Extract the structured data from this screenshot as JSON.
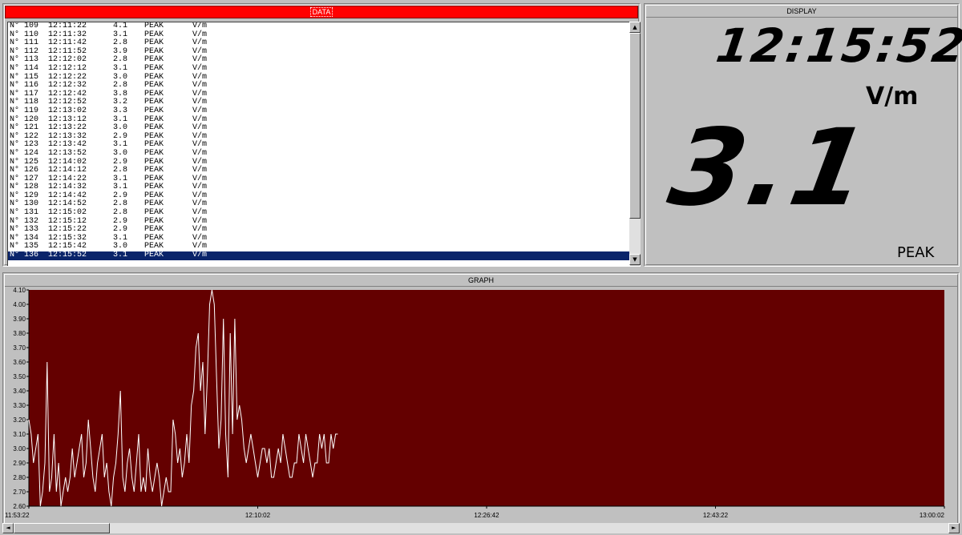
{
  "data_panel": {
    "title": "DATA",
    "selected_index": 27,
    "rows": [
      {
        "n": "N° 109",
        "time": "12:11:22",
        "value": "4.1",
        "mode": "PEAK",
        "unit": "V/m"
      },
      {
        "n": "N° 110",
        "time": "12:11:32",
        "value": "3.1",
        "mode": "PEAK",
        "unit": "V/m"
      },
      {
        "n": "N° 111",
        "time": "12:11:42",
        "value": "2.8",
        "mode": "PEAK",
        "unit": "V/m"
      },
      {
        "n": "N° 112",
        "time": "12:11:52",
        "value": "3.9",
        "mode": "PEAK",
        "unit": "V/m"
      },
      {
        "n": "N° 113",
        "time": "12:12:02",
        "value": "2.8",
        "mode": "PEAK",
        "unit": "V/m"
      },
      {
        "n": "N° 114",
        "time": "12:12:12",
        "value": "3.1",
        "mode": "PEAK",
        "unit": "V/m"
      },
      {
        "n": "N° 115",
        "time": "12:12:22",
        "value": "3.0",
        "mode": "PEAK",
        "unit": "V/m"
      },
      {
        "n": "N° 116",
        "time": "12:12:32",
        "value": "2.8",
        "mode": "PEAK",
        "unit": "V/m"
      },
      {
        "n": "N° 117",
        "time": "12:12:42",
        "value": "3.8",
        "mode": "PEAK",
        "unit": "V/m"
      },
      {
        "n": "N° 118",
        "time": "12:12:52",
        "value": "3.2",
        "mode": "PEAK",
        "unit": "V/m"
      },
      {
        "n": "N° 119",
        "time": "12:13:02",
        "value": "3.3",
        "mode": "PEAK",
        "unit": "V/m"
      },
      {
        "n": "N° 120",
        "time": "12:13:12",
        "value": "3.1",
        "mode": "PEAK",
        "unit": "V/m"
      },
      {
        "n": "N° 121",
        "time": "12:13:22",
        "value": "3.0",
        "mode": "PEAK",
        "unit": "V/m"
      },
      {
        "n": "N° 122",
        "time": "12:13:32",
        "value": "2.9",
        "mode": "PEAK",
        "unit": "V/m"
      },
      {
        "n": "N° 123",
        "time": "12:13:42",
        "value": "3.1",
        "mode": "PEAK",
        "unit": "V/m"
      },
      {
        "n": "N° 124",
        "time": "12:13:52",
        "value": "3.0",
        "mode": "PEAK",
        "unit": "V/m"
      },
      {
        "n": "N° 125",
        "time": "12:14:02",
        "value": "2.9",
        "mode": "PEAK",
        "unit": "V/m"
      },
      {
        "n": "N° 126",
        "time": "12:14:12",
        "value": "2.8",
        "mode": "PEAK",
        "unit": "V/m"
      },
      {
        "n": "N° 127",
        "time": "12:14:22",
        "value": "3.1",
        "mode": "PEAK",
        "unit": "V/m"
      },
      {
        "n": "N° 128",
        "time": "12:14:32",
        "value": "3.1",
        "mode": "PEAK",
        "unit": "V/m"
      },
      {
        "n": "N° 129",
        "time": "12:14:42",
        "value": "2.9",
        "mode": "PEAK",
        "unit": "V/m"
      },
      {
        "n": "N° 130",
        "time": "12:14:52",
        "value": "2.8",
        "mode": "PEAK",
        "unit": "V/m"
      },
      {
        "n": "N° 131",
        "time": "12:15:02",
        "value": "2.8",
        "mode": "PEAK",
        "unit": "V/m"
      },
      {
        "n": "N° 132",
        "time": "12:15:12",
        "value": "2.9",
        "mode": "PEAK",
        "unit": "V/m"
      },
      {
        "n": "N° 133",
        "time": "12:15:22",
        "value": "2.9",
        "mode": "PEAK",
        "unit": "V/m"
      },
      {
        "n": "N° 134",
        "time": "12:15:32",
        "value": "3.1",
        "mode": "PEAK",
        "unit": "V/m"
      },
      {
        "n": "N° 135",
        "time": "12:15:42",
        "value": "3.0",
        "mode": "PEAK",
        "unit": "V/m"
      },
      {
        "n": "N° 136",
        "time": "12:15:52",
        "value": "3.1",
        "mode": "PEAK",
        "unit": "V/m"
      }
    ]
  },
  "display_panel": {
    "title": "DISPLAY",
    "time": "12:15:52",
    "unit": "V/m",
    "value": "3.1",
    "mode": "PEAK"
  },
  "graph_panel": {
    "title": "GRAPH"
  },
  "icons": {
    "scroll_up": "scroll-up-arrow-icon",
    "scroll_down": "scroll-down-arrow-icon",
    "scroll_left": "scroll-left-arrow-icon",
    "scroll_right": "scroll-right-arrow-icon"
  },
  "colors": {
    "data_title_bg": "#ff0000",
    "graph_bg": "#640000",
    "trace": "#ffffff",
    "selection": "#0a246a"
  },
  "chart_data": {
    "type": "line",
    "ylim": [
      2.6,
      4.1
    ],
    "yticks": [
      "2.60",
      "2.70",
      "2.80",
      "2.90",
      "3.00",
      "3.10",
      "3.20",
      "3.30",
      "3.40",
      "3.50",
      "3.60",
      "3.70",
      "3.80",
      "3.90",
      "4.00",
      "4.10"
    ],
    "xticks": [
      "11:53:22",
      "12:10:02",
      "12:26:42",
      "12:43:22",
      "13:00:02"
    ],
    "x_start_label": "11:53:22",
    "x_end_label": "13:00:02",
    "sample_interval_s": 10,
    "series": [
      {
        "values": [
          3.2,
          3.1,
          2.9,
          3.0,
          3.1,
          2.6,
          2.7,
          2.9,
          3.6,
          2.7,
          2.8,
          3.1,
          2.7,
          2.9,
          2.6,
          2.7,
          2.8,
          2.7,
          2.8,
          3.0,
          2.8,
          2.9,
          3.0,
          3.1,
          2.8,
          2.9,
          3.2,
          3.0,
          2.8,
          2.7,
          2.9,
          3.0,
          3.1,
          2.8,
          2.9,
          2.7,
          2.6,
          2.8,
          2.9,
          3.1,
          3.4,
          2.8,
          2.7,
          2.9,
          3.0,
          2.8,
          2.7,
          2.9,
          3.1,
          2.7,
          2.8,
          2.7,
          3.0,
          2.8,
          2.7,
          2.8,
          2.9,
          2.8,
          2.6,
          2.7,
          2.8,
          2.7,
          2.7,
          3.2,
          3.1,
          2.9,
          3.0,
          2.8,
          2.9,
          3.1,
          2.9,
          3.3,
          3.4,
          3.7,
          3.8,
          3.4,
          3.6,
          3.1,
          3.5,
          4.0,
          4.1,
          4.0,
          3.5,
          3.0,
          3.2,
          3.9,
          3.1,
          2.8,
          3.8,
          3.1,
          3.9,
          3.2,
          3.3,
          3.2,
          3.0,
          2.9,
          3.0,
          3.1,
          3.0,
          2.9,
          2.8,
          2.9,
          3.0,
          3.0,
          2.9,
          3.0,
          2.8,
          2.8,
          2.9,
          3.0,
          2.9,
          3.1,
          3.0,
          2.9,
          2.8,
          2.8,
          2.9,
          2.9,
          3.1,
          3.0,
          2.9,
          3.1,
          3.0,
          2.9,
          2.8,
          2.9,
          2.9,
          3.1,
          3.0,
          3.1,
          2.9,
          2.9,
          3.1,
          3.0,
          3.1,
          3.1
        ]
      }
    ]
  }
}
